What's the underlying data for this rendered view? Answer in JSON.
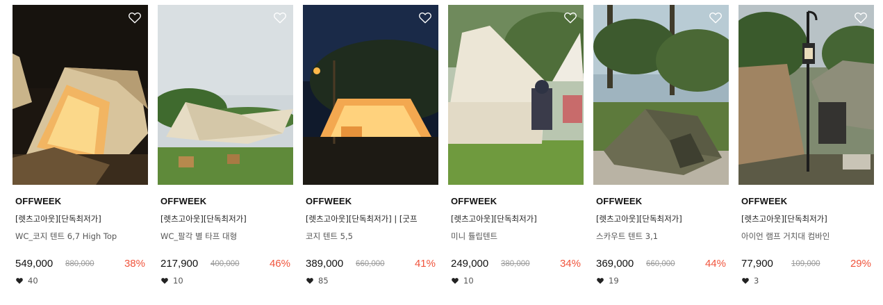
{
  "products": [
    {
      "brand": "OFFWEEK",
      "tags": "[렛츠고아웃][단독최저가]",
      "name": "WC_코지 텐트 6,7 High Top",
      "price": "549,000",
      "original_price": "880,000",
      "discount": "38%",
      "likes": "40",
      "image_icon": "tent-photo-night-glowing"
    },
    {
      "brand": "OFFWEEK",
      "tags": "[렛츠고아웃][단독최저가]",
      "name": "WC_팔각 별 타프 대형",
      "price": "217,900",
      "original_price": "400,000",
      "discount": "46%",
      "likes": "10",
      "image_icon": "tarp-photo-daytime"
    },
    {
      "brand": "OFFWEEK",
      "tags": "[렛츠고아웃][단독최저가] | [굿프",
      "name": "코지 텐트 5,5",
      "price": "389,000",
      "original_price": "660,000",
      "discount": "41%",
      "likes": "85",
      "image_icon": "tent-photo-dusk-lantern"
    },
    {
      "brand": "OFFWEEK",
      "tags": "[렛츠고아웃][단독최저가]",
      "name": "미니 튤립텐트",
      "price": "249,000",
      "original_price": "380,000",
      "discount": "34%",
      "likes": "10",
      "image_icon": "bell-tent-photo-child"
    },
    {
      "brand": "OFFWEEK",
      "tags": "[렛츠고아웃][단독최저가]",
      "name": "스카우트 텐트 3,1",
      "price": "369,000",
      "original_price": "660,000",
      "discount": "44%",
      "likes": "19",
      "image_icon": "scout-tent-photo-forest"
    },
    {
      "brand": "OFFWEEK",
      "tags": "[렛츠고아웃][단독최저가]",
      "name": "아이언 램프 거치대 컴바인",
      "price": "77,900",
      "original_price": "109,000",
      "discount": "29%",
      "likes": "3",
      "image_icon": "lamp-stand-photo"
    }
  ],
  "colors": {
    "discount": "#f0543c",
    "strikethrough": "#999999",
    "text": "#111111"
  },
  "icons": {
    "wishlist": "heart-outline-icon",
    "likes": "heart-filled-icon"
  }
}
